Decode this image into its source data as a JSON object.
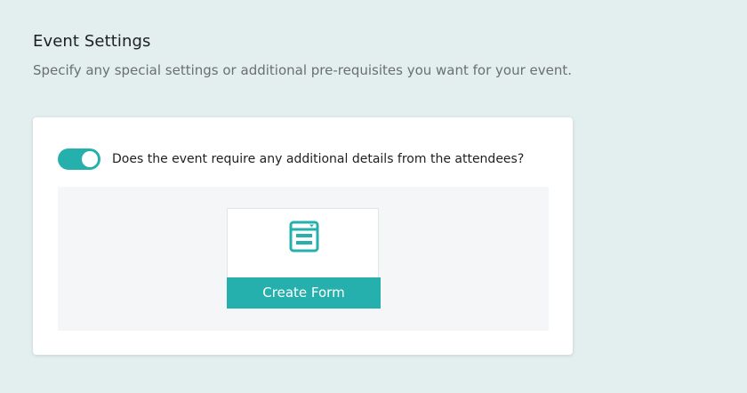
{
  "section": {
    "title": "Event Settings",
    "description": "Specify any special settings or additional pre-requisites you want for your event."
  },
  "settings": {
    "additional_details_toggle": {
      "label": "Does the event require any additional details from the attendees?",
      "state": "on"
    },
    "form_builder": {
      "icon": "form-icon",
      "button_label": "Create Form"
    }
  },
  "colors": {
    "accent": "#26b0ad",
    "page_background": "#e2efee",
    "card_background": "#ffffff",
    "form_area_background": "#f4f6f8"
  }
}
